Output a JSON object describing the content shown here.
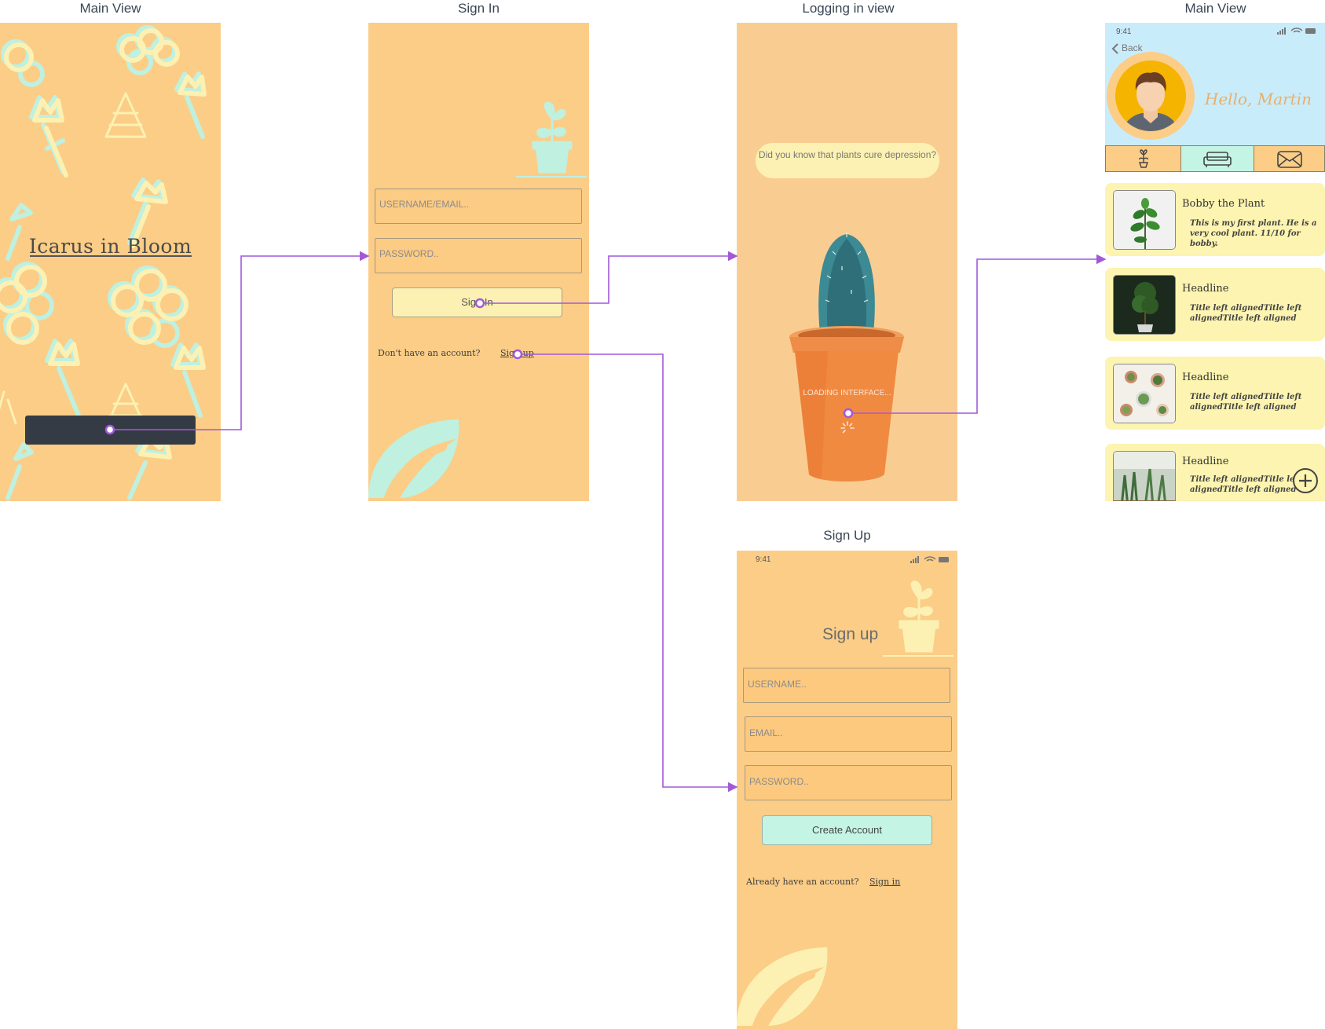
{
  "frames": {
    "main_view_1": {
      "title": "Main View"
    },
    "sign_in": {
      "title": "Sign In"
    },
    "logging_in": {
      "title": "Logging in view"
    },
    "main_view_2": {
      "title": "Main View"
    },
    "sign_up": {
      "title": "Sign Up"
    }
  },
  "splash": {
    "app_title": "Icarus in Bloom"
  },
  "sign_in": {
    "username_placeholder": "USERNAME/EMAIL..",
    "password_placeholder": "PASSWORD..",
    "signin_button": "Sign In",
    "no_account_prompt": "Don't have an account?",
    "signup_link": "Sign up"
  },
  "logging_in": {
    "fact_bubble": "Did you know that plants cure depression?",
    "loading_text": "LOADING INTERFACE..."
  },
  "home": {
    "status_time": "9:41",
    "back_label": "Back",
    "greeting": "Hello, Martin",
    "tabs": [
      {
        "icon": "plant-icon",
        "selected": false
      },
      {
        "icon": "sofa-icon",
        "selected": true
      },
      {
        "icon": "mail-icon",
        "selected": false
      }
    ],
    "cards": [
      {
        "title": "Bobby the Plant",
        "body": "This is my first plant. He is a very cool plant. 11/10 for bobby."
      },
      {
        "title": "Headline",
        "body": "Title left alignedTitle left alignedTitle left aligned"
      },
      {
        "title": "Headline",
        "body": "Title left alignedTitle left alignedTitle left aligned"
      },
      {
        "title": "Headline",
        "body": "Title left alignedTitle left alignedTitle left aligned"
      }
    ]
  },
  "sign_up": {
    "status_time": "9:41",
    "heading": "Sign up",
    "username_placeholder": "USERNAME..",
    "email_placeholder": "EMAIL..",
    "password_placeholder": "PASSWORD..",
    "create_button": "Create Account",
    "have_account_prompt": "Already have an account?",
    "signin_link": "Sign in"
  },
  "colors": {
    "screen_bg": "#fbcd87",
    "pattern_mint": "#bff0e0",
    "pattern_yellow": "#fcf1b2",
    "connector": "#a259d9",
    "header_blue": "#c9ecfb",
    "card_yellow": "#fcf4b0"
  }
}
